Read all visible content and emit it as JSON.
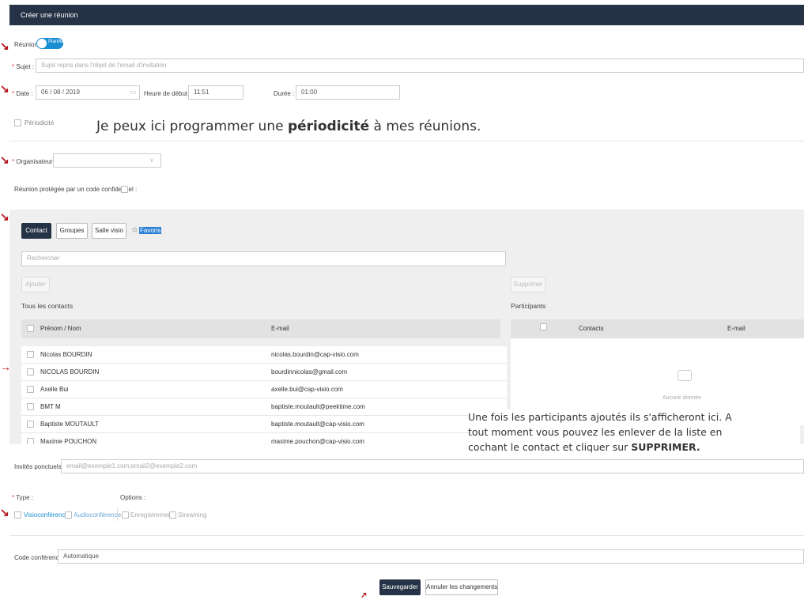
{
  "window": {
    "title": "Créer une réunion"
  },
  "reunion": {
    "label": "Réunion",
    "toggle_label": "Planifiée"
  },
  "sujet": {
    "label": "Sujet :",
    "placeholder": "Sujet repris dans l'objet de l'email d'invitation"
  },
  "date": {
    "label": "Date :",
    "value": "06 / 08 / 2019",
    "start_label": "Heure de début :",
    "start_value": "11:51",
    "duration_label": "Durée :",
    "duration_value": "01:00"
  },
  "periodicite": {
    "label": "Périodicité"
  },
  "annotation1": {
    "before": "Je peux ici programmer une ",
    "bold": "périodicité",
    "after": " à mes réunions."
  },
  "organisateur": {
    "label": "Organisateur :"
  },
  "code_protect": {
    "label": "Réunion protégée par un code confidentiel :"
  },
  "tabs": {
    "contact": "Contact",
    "groupes": "Groupes",
    "salle": "Salle visio",
    "favoris": "Favoris"
  },
  "search": {
    "placeholder": "Rechercher"
  },
  "buttons": {
    "ajouter": "Ajouter",
    "supprimer": "Supprimer",
    "save": "Sauvegarder",
    "cancel": "Annuler les changements"
  },
  "contacts": {
    "title": "Tous les contacts",
    "col_name": "Prénom / Nom",
    "col_email": "E-mail",
    "rows": [
      {
        "name": "Nicolas BOURDIN",
        "email": "nicolas.bourdin@cap-visio.com"
      },
      {
        "name": "NICOLAS BOURDIN",
        "email": "bourdinnicolas@gmail.com"
      },
      {
        "name": "Axelle Bui",
        "email": "axelle.bui@cap-visio.com"
      },
      {
        "name": "BMT M",
        "email": "baptiste.moutault@peektime.com"
      },
      {
        "name": "Baptiste MOUTAULT",
        "email": "baptiste.moutault@cap-visio.com"
      },
      {
        "name": "Maxime POUCHON",
        "email": "maxime.pouchon@cap-visio.com"
      }
    ]
  },
  "participants": {
    "title": "Participants",
    "col_contacts": "Contacts",
    "col_email": "E-mail",
    "empty": "Aucune donnée"
  },
  "annotation2": {
    "line1": "Une fois les participants ajoutés ils s'afficheront ici.  A",
    "line2": "tout moment vous pouvez les enlever de la liste en",
    "line3_before": "cochant le contact et cliquer sur ",
    "line3_bold": "SUPPRIMER."
  },
  "invites": {
    "label": "Invités ponctuels :",
    "placeholder": "email@exemple1.com;email2@exemple2.com"
  },
  "type": {
    "label": "Type :",
    "visio": "Visioconférence",
    "audio": "Audioconférence"
  },
  "options": {
    "label": "Options :",
    "enreg": "Enregistrement",
    "stream": "Streaming"
  },
  "code": {
    "label": "Code conférence :",
    "value": "Automatique"
  },
  "colors": {
    "header": "#263346",
    "toggle": "#1a8fd1",
    "arrow": "#b3141a"
  }
}
